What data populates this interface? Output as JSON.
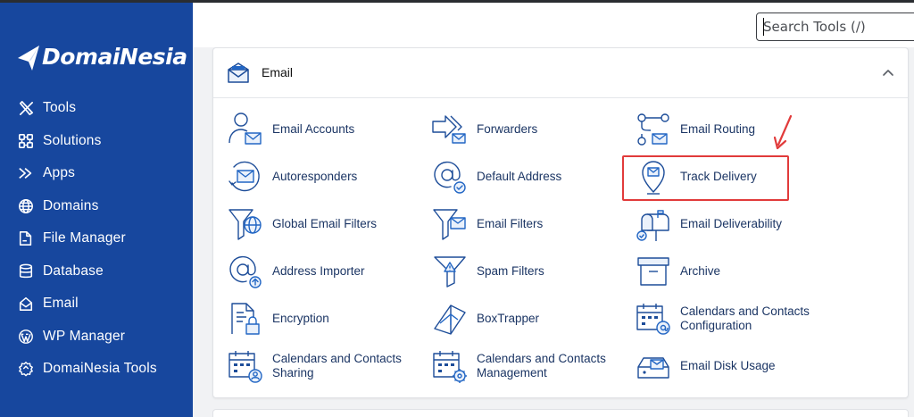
{
  "brand": {
    "name": "DomaiNesia",
    "accent": "#17479e",
    "icon_color": "#2266c4",
    "highlight_color": "#e13b3b"
  },
  "sidebar": {
    "items": [
      {
        "label": "Tools",
        "icon": "tools-icon"
      },
      {
        "label": "Solutions",
        "icon": "solutions-icon"
      },
      {
        "label": "Apps",
        "icon": "apps-icon"
      },
      {
        "label": "Domains",
        "icon": "globe-icon"
      },
      {
        "label": "File Manager",
        "icon": "file-manager-icon"
      },
      {
        "label": "Database",
        "icon": "database-icon"
      },
      {
        "label": "Email",
        "icon": "email-icon"
      },
      {
        "label": "WP Manager",
        "icon": "wordpress-icon"
      },
      {
        "label": "DomaiNesia Tools",
        "icon": "badge-icon"
      }
    ]
  },
  "search": {
    "placeholder": "Search Tools (/)"
  },
  "email_panel": {
    "title": "Email",
    "tools": {
      "email_accounts": "Email Accounts",
      "forwarders": "Forwarders",
      "email_routing": "Email Routing",
      "autoresponders": "Autoresponders",
      "default_address": "Default Address",
      "track_delivery": "Track Delivery",
      "global_email_filters": "Global Email Filters",
      "email_filters": "Email Filters",
      "email_deliverability": "Email Deliverability",
      "address_importer": "Address Importer",
      "spam_filters": "Spam Filters",
      "archive": "Archive",
      "encryption": "Encryption",
      "boxtrapper": "BoxTrapper",
      "cal_config_1": "Calendars and Contacts",
      "cal_config_2": "Configuration",
      "cal_sharing_1": "Calendars and Contacts",
      "cal_sharing_2": "Sharing",
      "cal_mgmt_1": "Calendars and Contacts",
      "cal_mgmt_2": "Management",
      "email_disk_usage": "Email Disk Usage"
    }
  }
}
